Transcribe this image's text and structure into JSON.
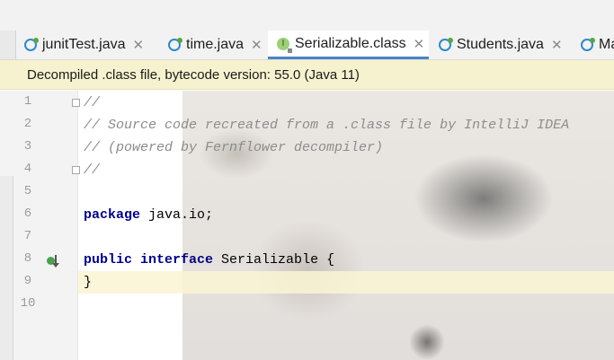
{
  "tabs": [
    {
      "label": "junitTest.java",
      "icon": "java-class-icon",
      "active": false
    },
    {
      "label": "time.java",
      "icon": "java-class-icon",
      "active": false
    },
    {
      "label": "Serializable.class",
      "icon": "interface-icon",
      "icon_glyph": "I",
      "active": true
    },
    {
      "label": "Students.java",
      "icon": "java-class-icon",
      "active": false
    },
    {
      "label": "Ma",
      "icon": "java-class-icon",
      "active": false
    }
  ],
  "tab_close_glyph": "✕",
  "banner": {
    "text": "Decompiled .class file, bytecode version: 55.0 (Java 11)"
  },
  "line_numbers": [
    "1",
    "2",
    "3",
    "4",
    "5",
    "6",
    "7",
    "8",
    "9",
    "10"
  ],
  "code": {
    "line1": "//",
    "line2": "// Source code recreated from a .class file by IntelliJ IDEA",
    "line3": "// (powered by Fernflower decompiler)",
    "line4": "//",
    "line6_kw": "package",
    "line6_rest": " java.io;",
    "line8_kw1": "public",
    "line8_kw2": "interface",
    "line8_rest": " Serializable {",
    "line9": "}"
  },
  "colors": {
    "banner_bg": "#f6f2cf",
    "keyword": "#000080",
    "comment": "#8c8c8c",
    "active_tab_underline": "#4a84c4"
  }
}
